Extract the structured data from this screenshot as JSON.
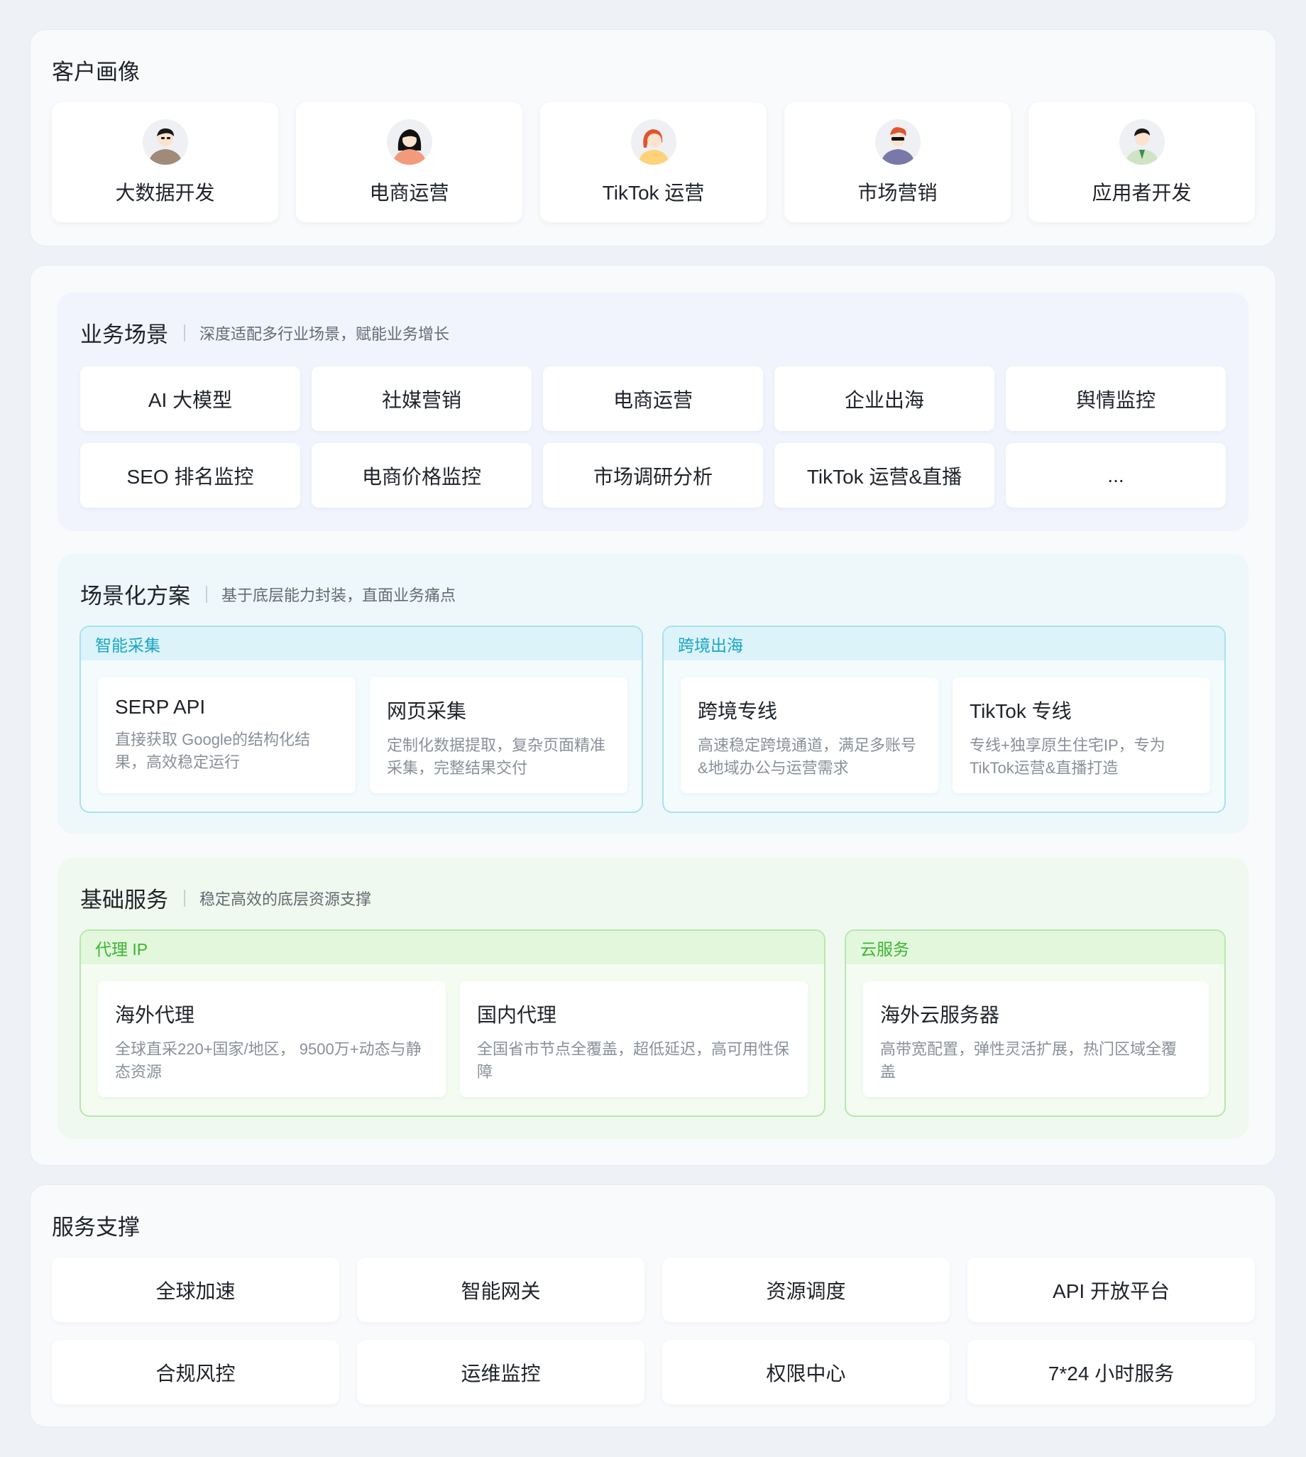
{
  "customers": {
    "title": "客户画像",
    "items": [
      {
        "label": "大数据开发",
        "icon": "big-data-dev-avatar-icon",
        "shirt": "#a08a7a",
        "hair": "#1a1a1a"
      },
      {
        "label": "电商运营",
        "icon": "ecommerce-ops-avatar-icon",
        "shirt": "#f49a7c",
        "hair": "#111111"
      },
      {
        "label": "TikTok 运营",
        "icon": "tiktok-ops-avatar-icon",
        "shirt": "#ffd27a",
        "hair": "#e0542f"
      },
      {
        "label": "市场营销",
        "icon": "marketing-avatar-icon",
        "shirt": "#7a78a8",
        "hair": "#e0542f"
      },
      {
        "label": "应用者开发",
        "icon": "app-dev-avatar-icon",
        "shirt": "#cfe3c5",
        "hair": "#1a1a1a"
      }
    ]
  },
  "scenes": {
    "title": "业务场景",
    "subtitle": "深度适配多行业场景，赋能业务增长",
    "items": [
      "AI 大模型",
      "社媒营销",
      "电商运营",
      "企业出海",
      "舆情监控",
      "SEO 排名监控",
      "电商价格监控",
      "市场调研分析",
      "TikTok 运营&直播",
      "..."
    ]
  },
  "solutions": {
    "title": "场景化方案",
    "subtitle": "基于底层能力封装，直面业务痛点",
    "groups": [
      {
        "label": "智能采集",
        "cards": [
          {
            "title": "SERP API",
            "desc": "直接获取 Google的结构化结果，高效稳定运行"
          },
          {
            "title": "网页采集",
            "desc": "定制化数据提取，复杂页面精准采集，完整结果交付"
          }
        ]
      },
      {
        "label": "跨境出海",
        "cards": [
          {
            "title": "跨境专线",
            "desc": "高速稳定跨境通道，满足多账号&地域办公与运营需求"
          },
          {
            "title": "TikTok 专线",
            "desc": "专线+独享原生住宅IP，专为TikTok运营&直播打造"
          }
        ]
      }
    ]
  },
  "infra": {
    "title": "基础服务",
    "subtitle": "稳定高效的底层资源支撑",
    "groups": [
      {
        "label": "代理 IP",
        "cards": [
          {
            "title": "海外代理",
            "desc": "全球直采220+国家/地区， 9500万+动态与静态资源"
          },
          {
            "title": "国内代理",
            "desc": "全国省市节点全覆盖，超低延迟，高可用性保障"
          }
        ]
      },
      {
        "label": "云服务",
        "cards": [
          {
            "title": "海外云服务器",
            "desc": "高带宽配置，弹性灵活扩展，热门区域全覆盖"
          }
        ]
      }
    ]
  },
  "support": {
    "title": "服务支撑",
    "items": [
      "全球加速",
      "智能网关",
      "资源调度",
      "API 开放平台",
      "合规风控",
      "运维监控",
      "权限中心",
      "7*24 小时服务"
    ]
  }
}
